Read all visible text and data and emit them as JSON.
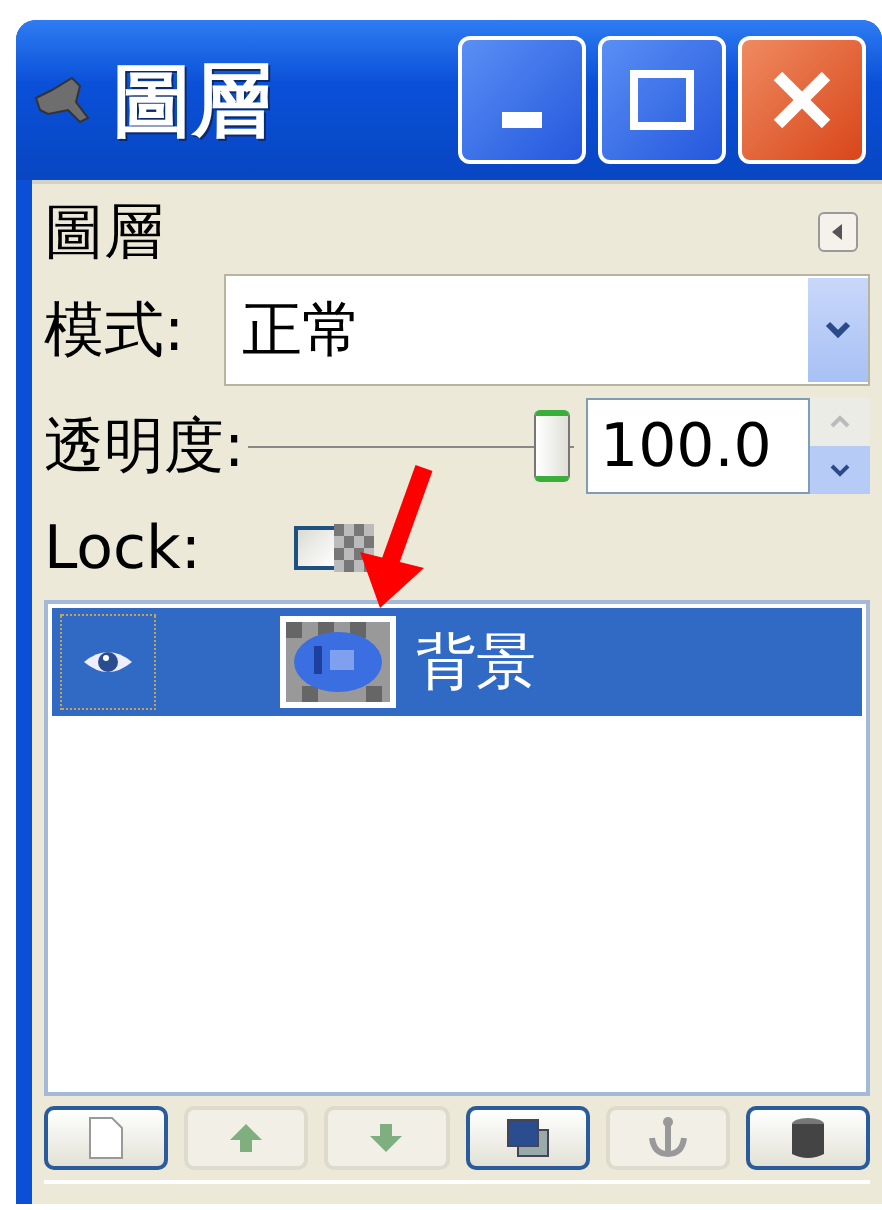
{
  "window": {
    "title": "圖層"
  },
  "panel": {
    "title": "圖層"
  },
  "mode": {
    "label": "模式:",
    "value": "正常"
  },
  "opacity": {
    "label": "透明度:",
    "level": 1.0,
    "value": "100.0"
  },
  "lock": {
    "label": "Lock:",
    "checked": false
  },
  "layers": [
    {
      "name": "背景",
      "visible": true,
      "selected": true
    }
  ],
  "buttons": [
    {
      "kind": "new",
      "disabled": false
    },
    {
      "kind": "raise",
      "disabled": true
    },
    {
      "kind": "lower",
      "disabled": true
    },
    {
      "kind": "duplicate",
      "disabled": false
    },
    {
      "kind": "anchor",
      "disabled": true
    },
    {
      "kind": "delete",
      "disabled": false
    }
  ]
}
